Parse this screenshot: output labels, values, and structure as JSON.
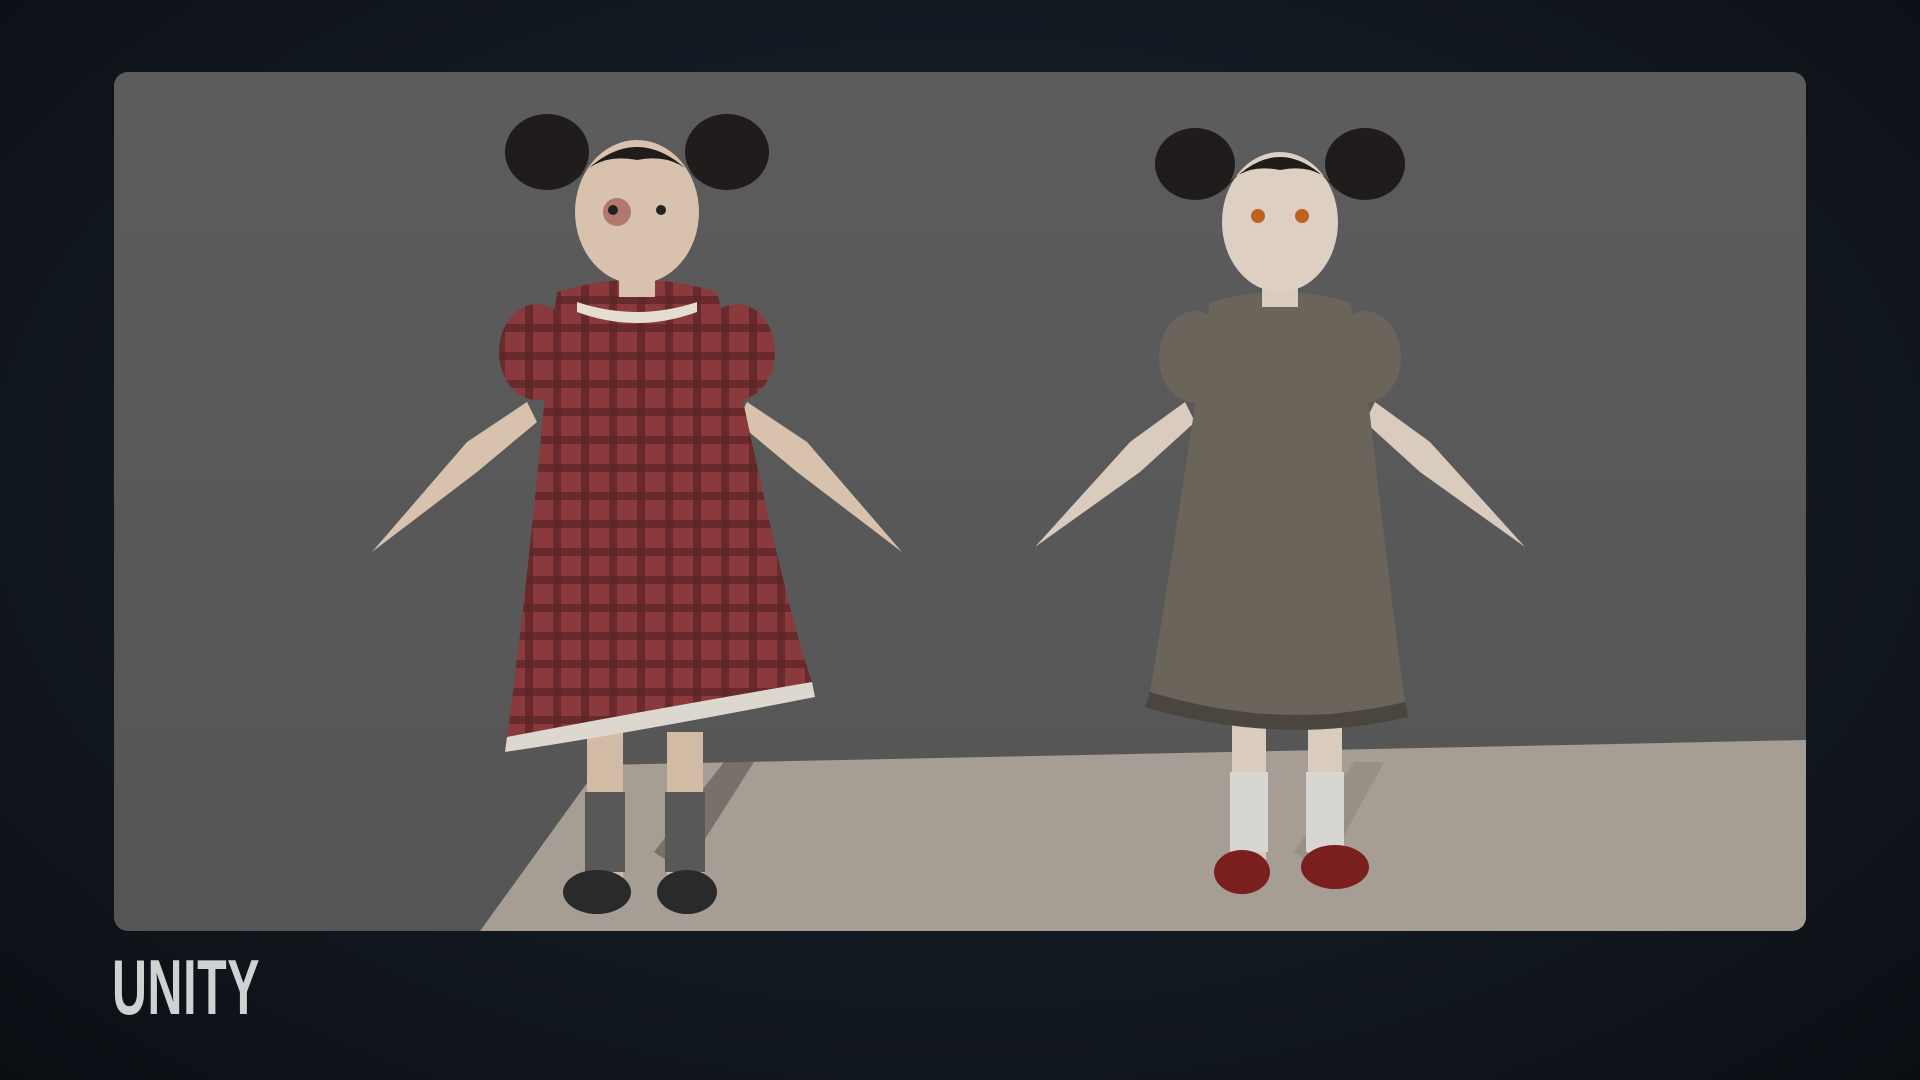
{
  "caption": {
    "label": "UNITY"
  },
  "colors": {
    "backdrop": "#5a5a5a",
    "floor": "#a69d94",
    "background": "#121820",
    "caption": "#cfd1d3"
  },
  "characters": [
    {
      "name": "bloody-doll-girl",
      "dress": "#8a3a3c",
      "shoes": "#2a2a2a"
    },
    {
      "name": "pale-doll-girl",
      "dress": "#6a645a",
      "shoes": "#7a1e1e"
    }
  ]
}
